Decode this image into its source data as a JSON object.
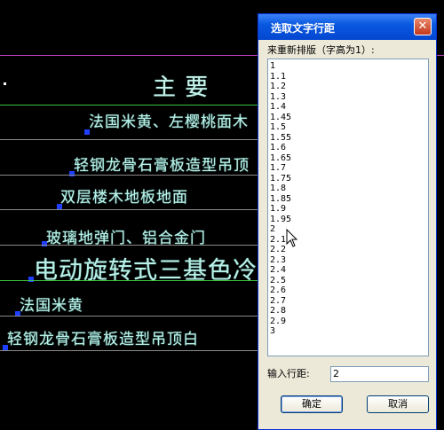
{
  "cad": {
    "title_chars": "主   要",
    "lines": [
      "法国米黄、左樱桃面木",
      "轻钢龙骨石膏板造型吊顶",
      "双层楼木地板地面",
      "玻璃地弹门、铝合金门",
      "电动旋转式三基色冷",
      "法国米黄",
      "轻钢龙骨石膏板造型吊顶白"
    ],
    "colors": {
      "background": "#000000",
      "text": "#b8f0e8",
      "green_line": "#3cc43c",
      "magenta_line": "#c040c0",
      "grip": "#1f3fff"
    }
  },
  "dialog": {
    "title": "选取文字行距",
    "close_label": "✕",
    "list_label": "来重新排版（字高为1）:",
    "items": [
      "1",
      "1.1",
      "1.2",
      "1.3",
      "1.4",
      "1.45",
      "1.5",
      "1.55",
      "1.6",
      "1.65",
      "1.7",
      "1.75",
      "1.8",
      "1.85",
      "1.9",
      "1.95",
      "2",
      "2.1",
      "2.2",
      "2.3",
      "2.4",
      "2.5",
      "2.6",
      "2.7",
      "2.8",
      "2.9",
      "3"
    ],
    "input_label": "输入行距:",
    "input_value": "2",
    "ok_label": "确定",
    "cancel_label": "取消"
  }
}
